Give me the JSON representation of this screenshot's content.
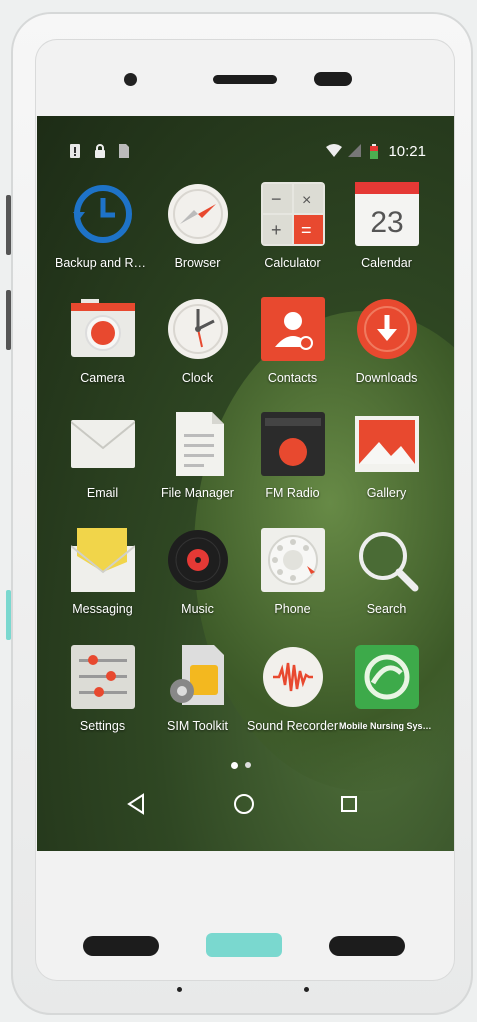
{
  "status_bar": {
    "time": "10:21",
    "left_icons": [
      "alert-icon",
      "lock-icon",
      "sim-icon"
    ],
    "right_icons": [
      "wifi-icon",
      "signal-icon",
      "battery-icon"
    ]
  },
  "apps": [
    {
      "label": "Backup and Re...",
      "icon": "backup-icon"
    },
    {
      "label": "Browser",
      "icon": "browser-icon"
    },
    {
      "label": "Calculator",
      "icon": "calculator-icon"
    },
    {
      "label": "Calendar",
      "icon": "calendar-icon",
      "badge": "23"
    },
    {
      "label": "Camera",
      "icon": "camera-icon"
    },
    {
      "label": "Clock",
      "icon": "clock-icon"
    },
    {
      "label": "Contacts",
      "icon": "contacts-icon"
    },
    {
      "label": "Downloads",
      "icon": "downloads-icon"
    },
    {
      "label": "Email",
      "icon": "email-icon"
    },
    {
      "label": "File Manager",
      "icon": "file-manager-icon"
    },
    {
      "label": "FM Radio",
      "icon": "fm-radio-icon"
    },
    {
      "label": "Gallery",
      "icon": "gallery-icon"
    },
    {
      "label": "Messaging",
      "icon": "messaging-icon"
    },
    {
      "label": "Music",
      "icon": "music-icon"
    },
    {
      "label": "Phone",
      "icon": "phone-icon"
    },
    {
      "label": "Search",
      "icon": "search-icon"
    },
    {
      "label": "Settings",
      "icon": "settings-icon"
    },
    {
      "label": "SIM Toolkit",
      "icon": "sim-toolkit-icon"
    },
    {
      "label": "Sound Recorder",
      "icon": "sound-recorder-icon"
    },
    {
      "label": "Mobile Nursing System",
      "icon": "mobile-nursing-icon"
    }
  ],
  "page_indicator": {
    "pages": 2,
    "current": 1
  },
  "nav_bar": [
    "back-icon",
    "home-icon",
    "recents-icon"
  ],
  "colors": {
    "accent_red": "#e8492f",
    "teal_button": "#7ad8cf",
    "calendar_red": "#e53935",
    "nursing_green": "#3daa4a"
  }
}
